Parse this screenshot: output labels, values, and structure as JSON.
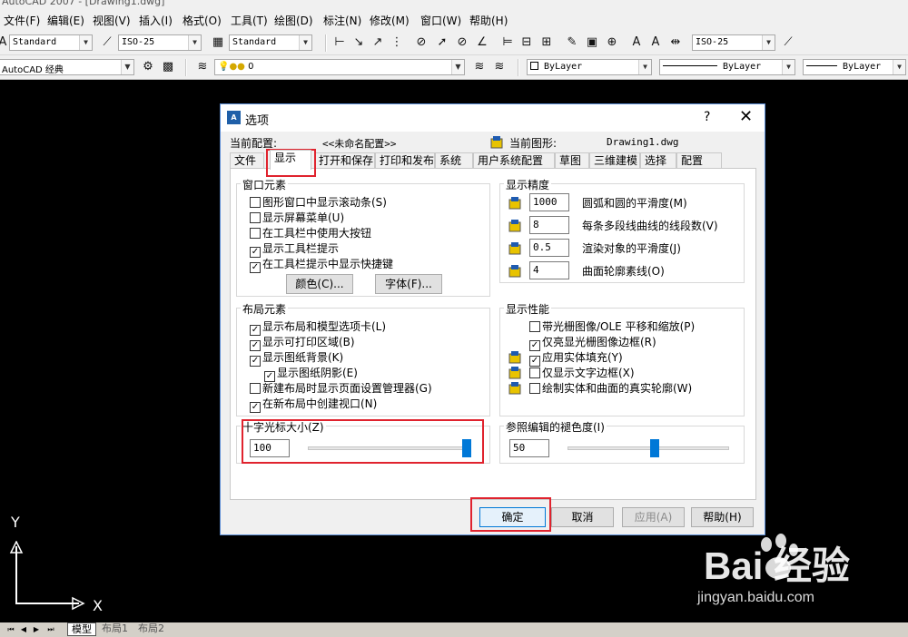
{
  "window": {
    "title_fragment": "AutoCAD 2007 - [Drawing1.dwg]"
  },
  "menu": [
    "文件(F)",
    "编辑(E)",
    "视图(V)",
    "插入(I)",
    "格式(O)",
    "工具(T)",
    "绘图(D)",
    "标注(N)",
    "修改(M)",
    "窗口(W)",
    "帮助(H)"
  ],
  "toolbar": {
    "text_style": "Standard",
    "dim_style": "ISO-25",
    "table_style": "Standard",
    "mleader_style": "ISO-25",
    "workspace": "AutoCAD 经典",
    "layer": "0",
    "color": "ByLayer",
    "linetype": "ByLayer",
    "lineweight": "ByLayer"
  },
  "dialog": {
    "title": "选项",
    "help_glyph": "?",
    "close_glyph": "✕",
    "current_profile_label": "当前配置:",
    "current_profile_value": "<<未命名配置>>",
    "current_drawing_label": "当前图形:",
    "current_drawing_value": "Drawing1.dwg",
    "tabs": [
      "文件",
      "显示",
      "打开和保存",
      "打印和发布",
      "系统",
      "用户系统配置",
      "草图",
      "三维建模",
      "选择",
      "配置"
    ],
    "active_tab": "显示",
    "window_elements": {
      "title": "窗口元素",
      "items": [
        {
          "label": "图形窗口中显示滚动条(S)",
          "checked": false
        },
        {
          "label": "显示屏幕菜单(U)",
          "checked": false
        },
        {
          "label": "在工具栏中使用大按钮",
          "checked": false
        },
        {
          "label": "显示工具栏提示",
          "checked": true
        },
        {
          "label": "在工具栏提示中显示快捷键",
          "checked": true
        }
      ],
      "colors_button": "颜色(C)...",
      "fonts_button": "字体(F)..."
    },
    "display_resolution": {
      "title": "显示精度",
      "items": [
        {
          "value": "1000",
          "label": "圆弧和圆的平滑度(M)"
        },
        {
          "value": "8",
          "label": "每条多段线曲线的线段数(V)"
        },
        {
          "value": "0.5",
          "label": "渲染对象的平滑度(J)"
        },
        {
          "value": "4",
          "label": "曲面轮廓素线(O)"
        }
      ]
    },
    "layout_elements": {
      "title": "布局元素",
      "items": [
        {
          "label": "显示布局和模型选项卡(L)",
          "checked": true
        },
        {
          "label": "显示可打印区域(B)",
          "checked": true
        },
        {
          "label": "显示图纸背景(K)",
          "checked": true
        },
        {
          "label": "显示图纸阴影(E)",
          "checked": true
        },
        {
          "label": "新建布局时显示页面设置管理器(G)",
          "checked": false
        },
        {
          "label": "在新布局中创建视口(N)",
          "checked": true
        }
      ]
    },
    "display_performance": {
      "title": "显示性能",
      "items": [
        {
          "label": "带光栅图像/OLE 平移和缩放(P)",
          "checked": false
        },
        {
          "label": "仅亮显光栅图像边框(R)",
          "checked": true
        },
        {
          "label": "应用实体填充(Y)",
          "checked": true
        },
        {
          "label": "仅显示文字边框(X)",
          "checked": false
        },
        {
          "label": "绘制实体和曲面的真实轮廓(W)",
          "checked": false
        }
      ]
    },
    "crosshair": {
      "title": "十字光标大小(Z)",
      "value": "100",
      "slider_fraction": 1.0
    },
    "xref_fade": {
      "title": "参照编辑的褪色度(I)",
      "value": "50",
      "slider_fraction": 0.54
    },
    "buttons": {
      "ok": "确定",
      "cancel": "取消",
      "apply": "应用(A)",
      "help": "帮助(H)"
    }
  },
  "ucs": {
    "y_label": "Y",
    "x_label": "X"
  },
  "layout_tabs": [
    "模型",
    "布局1",
    "布局2"
  ],
  "watermark": {
    "main": "Bai 经验",
    "sub": "jingyan.baidu.com"
  }
}
